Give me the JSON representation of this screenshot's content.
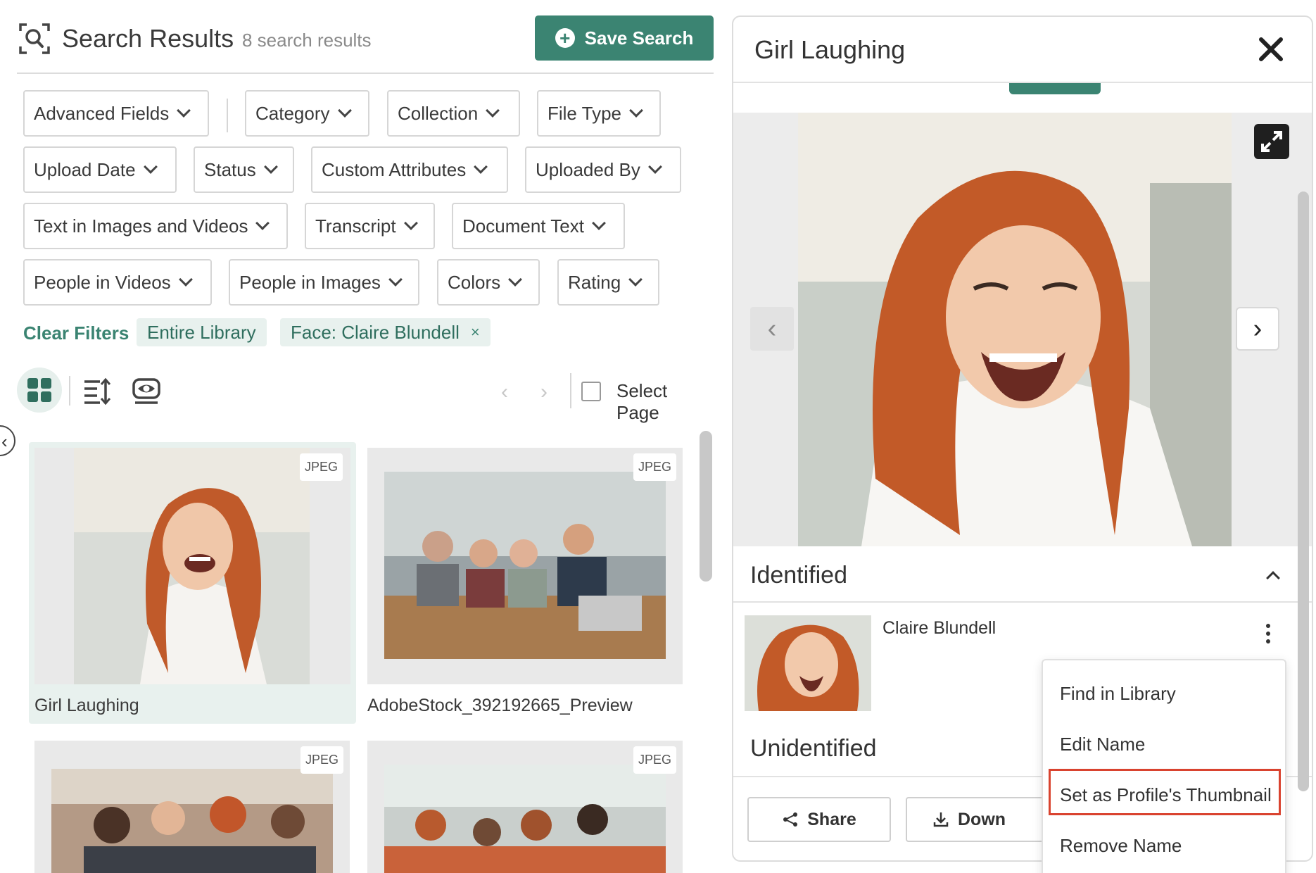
{
  "header": {
    "title": "Search Results",
    "result_count": "8 search results",
    "save_search_label": "Save Search"
  },
  "filters": [
    "Advanced Fields",
    "Category",
    "Collection",
    "File Type",
    "Upload Date",
    "Status",
    "Custom Attributes",
    "Uploaded By",
    "Text in Images and Videos",
    "Transcript",
    "Document Text",
    "People in Videos",
    "People in Images",
    "Colors",
    "Rating"
  ],
  "active_filters": {
    "clear_label": "Clear Filters",
    "chips": [
      "Entire Library",
      "Face: Claire Blundell"
    ],
    "remove_symbol": "×"
  },
  "toolbar": {
    "prev_symbol": "‹",
    "next_symbol": "›",
    "select_page_label": "Select Page"
  },
  "results": [
    {
      "name": "Girl Laughing",
      "type": "JPEG",
      "selected": true
    },
    {
      "name": "AdobeStock_392192665_Preview",
      "type": "JPEG",
      "selected": false
    },
    {
      "name": "",
      "type": "JPEG",
      "selected": false
    },
    {
      "name": "",
      "type": "JPEG",
      "selected": false
    }
  ],
  "detail": {
    "title": "Girl Laughing",
    "close_symbol": "✕",
    "identified_label": "Identified",
    "person_name": "Claire Blundell",
    "unidentified_label": "Unidentified",
    "share_label": "Share",
    "download_label": "Down"
  },
  "context_menu": {
    "items": [
      "Find in Library",
      "Edit Name",
      "Set as Profile's Thumbnail",
      "Remove Name"
    ],
    "highlighted_index": 2
  },
  "colors": {
    "accent": "#3b8472",
    "accent_light": "#e8f1ee",
    "highlight_border": "#d9432f"
  },
  "icons": {
    "header": "face-search-icon",
    "save": "plus-circle-icon",
    "views": [
      "grid-view-icon",
      "sort-icon",
      "eye-icon"
    ],
    "viewer": [
      "expand-icon",
      "chevron-left-icon",
      "chevron-right-icon"
    ],
    "buttons": [
      "share-icon",
      "download-icon"
    ]
  }
}
